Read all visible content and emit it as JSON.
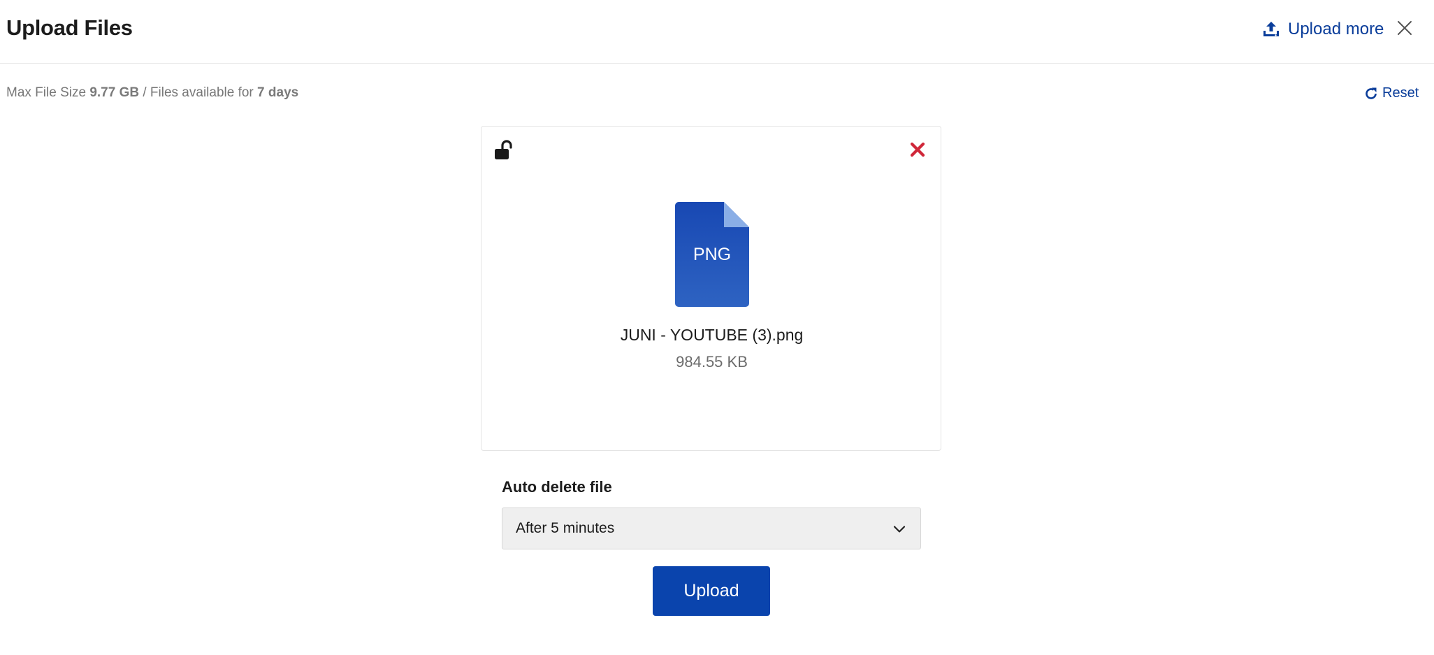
{
  "header": {
    "title": "Upload Files",
    "upload_more_label": "Upload more"
  },
  "info": {
    "max_size_label": "Max File Size",
    "max_size_value": "9.77 GB",
    "separator": "/ Files available for",
    "availability_value": "7 days",
    "reset_label": "Reset"
  },
  "file": {
    "type": "PNG",
    "name": "JUNI - YOUTUBE (3).png",
    "size": "984.55 KB"
  },
  "auto_delete": {
    "label": "Auto delete file",
    "selected": "After 5 minutes"
  },
  "actions": {
    "upload_label": "Upload"
  },
  "colors": {
    "accent": "#0a44ad",
    "link": "#0a3d9a",
    "danger": "#d0283a",
    "file_icon": "#1b52bb"
  },
  "icons": [
    "upload-icon",
    "close-icon",
    "reset-icon",
    "unlock-icon",
    "remove-icon",
    "file-png-icon",
    "chevron-down-icon"
  ]
}
